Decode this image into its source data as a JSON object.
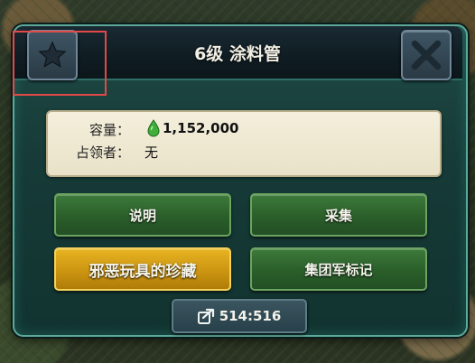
{
  "dialog": {
    "title": "6级 涂料管",
    "star_icon": "star-icon",
    "close_icon": "close-icon"
  },
  "info": {
    "capacity_label": "容量：",
    "capacity_value": "1,152,000",
    "capacity_icon": "green-drop-icon",
    "occupant_label": "占领者：",
    "occupant_value": "无"
  },
  "buttons": {
    "explain": "说明",
    "gather": "采集",
    "treasure": "邪恶玩具的珍藏",
    "group_mark": "集团军标记"
  },
  "coordinates": {
    "icon": "share-icon",
    "value": "514:516"
  },
  "colors": {
    "accent_green": "#2a5e2a",
    "accent_gold": "#c99210",
    "highlight_red": "#e24a4a",
    "panel_teal": "#163a37"
  }
}
